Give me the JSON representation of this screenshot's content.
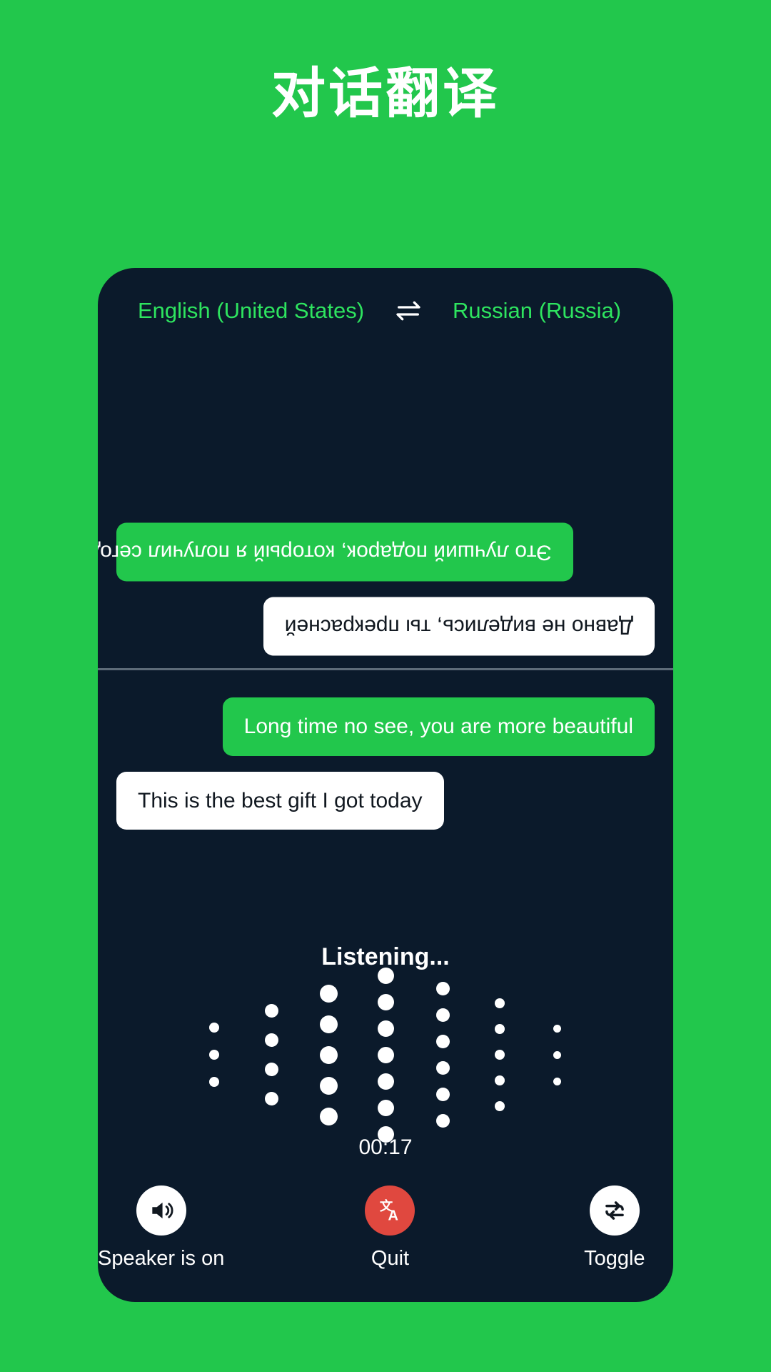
{
  "page": {
    "title": "对话翻译",
    "background_color": "#22c74c",
    "panel_color": "#0b1a2b",
    "accent_green": "#22c74c",
    "bubble_green": "#22c74c",
    "bubble_white": "#ffffff",
    "lang_text_color": "#2ee45f",
    "quit_color": "#e0483f"
  },
  "language_bar": {
    "source_language": "English (United States)",
    "swap_icon": "swap-horizontal-icon",
    "target_language": "Russian (Russia)"
  },
  "conversation": {
    "remote_panel": {
      "rotated": true,
      "messages": [
        {
          "text": "Это лучший подарок, который я получил сегодня",
          "style": "green",
          "align": "right"
        },
        {
          "text": "Давно не виделись, ты прекрасней",
          "style": "white",
          "align": "left"
        }
      ]
    },
    "local_panel": {
      "rotated": false,
      "messages": [
        {
          "text": "Long time no see, you are more beautiful",
          "style": "green",
          "align": "right"
        },
        {
          "text": "This is the best gift I got today",
          "style": "white",
          "align": "left"
        }
      ]
    }
  },
  "listening": {
    "status_text": "Listening...",
    "timer": "00:17",
    "waveform": {
      "columns": [
        {
          "dots": 3,
          "size": 14,
          "gap": 24
        },
        {
          "dots": 4,
          "size": 19,
          "gap": 22
        },
        {
          "dots": 5,
          "size": 25,
          "gap": 18
        },
        {
          "dots": 7,
          "size": 23,
          "gap": 14
        },
        {
          "dots": 6,
          "size": 19,
          "gap": 18
        },
        {
          "dots": 5,
          "size": 14,
          "gap": 22
        },
        {
          "dots": 3,
          "size": 11,
          "gap": 26
        }
      ]
    }
  },
  "controls": [
    {
      "icon": "speaker-on-icon",
      "label": "Speaker is on",
      "circle": "white"
    },
    {
      "icon": "translate-icon",
      "label": "Quit",
      "circle": "red"
    },
    {
      "icon": "toggle-swap-icon",
      "label": "Toggle",
      "circle": "white"
    }
  ]
}
